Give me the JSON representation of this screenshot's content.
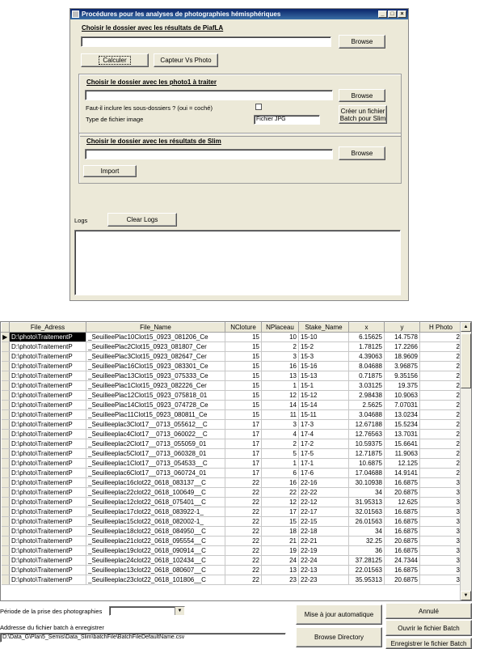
{
  "window": {
    "title": "Procédures pour les analyses de photographies hémisphériques",
    "minimize": "_",
    "maximize": "□",
    "close": "×"
  },
  "piafla": {
    "title": "Choisir le dossier avec les résultats de PiafLA",
    "path_value": "",
    "browse_label": "Browse",
    "calculer_label": "Calculer",
    "capteur_label": "Capteur Vs Photo"
  },
  "photo": {
    "title": "Choisir le dossier avec les photo1 à traiter",
    "path_value": "",
    "browse_label": "Browse",
    "subfolders_label": "Faut-il inclure les sous-dossiers ? (oui = coché)",
    "filetype_label": "Type de fichier image",
    "filetype_value": "Fichier JPG",
    "batch_label": "Créer un fichier Batch pour Slim"
  },
  "slim": {
    "title": "Choisir le dossier avec les résultats de Slim",
    "path_value": "",
    "browse_label": "Browse",
    "import_label": "Import"
  },
  "logs": {
    "label": "Logs",
    "clear_label": "Clear Logs",
    "text": ""
  },
  "table": {
    "columns": [
      "File_Adress",
      "File_Name",
      "NCloture",
      "NPlaceau",
      "Stake_Name",
      "x",
      "y",
      "H Photo"
    ],
    "rows": [
      [
        "D:\\photo\\TraitementP",
        "_SeuilleePlac10Clot15_0923_081206_Ce",
        "15",
        "10",
        "15-10",
        "6.15625",
        "14.7578",
        "2"
      ],
      [
        "D:\\photo\\TraitementP",
        "_SeuilleePlac2Clot15_0923_081807_Cer",
        "15",
        "2",
        "15-2",
        "1.78125",
        "17.2266",
        "2"
      ],
      [
        "D:\\photo\\TraitementP",
        "_SeuilleePlac3Clot15_0923_082647_Cer",
        "15",
        "3",
        "15-3",
        "4.39063",
        "18.9609",
        "2"
      ],
      [
        "D:\\photo\\TraitementP",
        "_SeuilleePlac16Clot15_0923_083301_Ce",
        "15",
        "16",
        "15-16",
        "8.04688",
        "3.96875",
        "2"
      ],
      [
        "D:\\photo\\TraitementP",
        "_SeuilleePlac13Clot15_0923_075333_Ce",
        "15",
        "13",
        "15-13",
        "0.71875",
        "9.35156",
        "2"
      ],
      [
        "D:\\photo\\TraitementP",
        "_SeuilleePlac1Clot15_0923_082226_Cer",
        "15",
        "1",
        "15-1",
        "3.03125",
        "19.375",
        "2"
      ],
      [
        "D:\\photo\\TraitementP",
        "_SeuilleePlac12Clot15_0923_075818_01",
        "15",
        "12",
        "15-12",
        "2.98438",
        "10.9063",
        "2"
      ],
      [
        "D:\\photo\\TraitementP",
        "_SeuilleePlac14Clot15_0923_074728_Ce",
        "15",
        "14",
        "15-14",
        "2.5625",
        "7.07031",
        "2"
      ],
      [
        "D:\\photo\\TraitementP",
        "_SeuilleePlac11Clot15_0923_080811_Ce",
        "15",
        "11",
        "15-11",
        "3.04688",
        "13.0234",
        "2"
      ],
      [
        "D:\\photo\\TraitementP",
        "_Seuilleeplac3Clot17__0713_055612__C",
        "17",
        "3",
        "17-3",
        "12.67188",
        "15.5234",
        "2"
      ],
      [
        "D:\\photo\\TraitementP",
        "_Seuilleeplac4Clot17__0713_060022__C",
        "17",
        "4",
        "17-4",
        "12.76563",
        "13.7031",
        "2"
      ],
      [
        "D:\\photo\\TraitementP",
        "_Seuilleeplac2Clot17__0713_055059_01",
        "17",
        "2",
        "17-2",
        "10.59375",
        "15.6641",
        "2"
      ],
      [
        "D:\\photo\\TraitementP",
        "_Seuilleeplac5Clot17__0713_060328_01",
        "17",
        "5",
        "17-5",
        "12.71875",
        "11.9063",
        "2"
      ],
      [
        "D:\\photo\\TraitementP",
        "_Seuilleeplac1Clot17__0713_054533__C",
        "17",
        "1",
        "17-1",
        "10.6875",
        "12.125",
        "2"
      ],
      [
        "D:\\photo\\TraitementP",
        "_Seuilleeplac6Clot17__0713_060724_01",
        "17",
        "6",
        "17-6",
        "17.04688",
        "14.9141",
        "2"
      ],
      [
        "D:\\photo\\TraitementP",
        "_Seuilleeplac16clot22_0618_083137__C",
        "22",
        "16",
        "22-16",
        "30.10938",
        "16.6875",
        "3"
      ],
      [
        "D:\\photo\\TraitementP",
        "_Seuilleeplac22clot22_0618_100649__C",
        "22",
        "22",
        "22-22",
        "34",
        "20.6875",
        "3"
      ],
      [
        "D:\\photo\\TraitementP",
        "_Seuilleeplac12clot22_0618_075401__C",
        "22",
        "12",
        "22-12",
        "31.95313",
        "12.625",
        "3"
      ],
      [
        "D:\\photo\\TraitementP",
        "_Seuilleeplac17clot22_0618_083922-1_",
        "22",
        "17",
        "22-17",
        "32.01563",
        "16.6875",
        "3"
      ],
      [
        "D:\\photo\\TraitementP",
        "_Seuilleeplac15clot22_0618_082002-1_",
        "22",
        "15",
        "22-15",
        "26.01563",
        "16.6875",
        "3"
      ],
      [
        "D:\\photo\\TraitementP",
        "_Seuilleeplac18clot22_0618_084950__C",
        "22",
        "18",
        "22-18",
        "34",
        "16.6875",
        "3"
      ],
      [
        "D:\\photo\\TraitementP",
        "_Seuilleeplac21clot22_0618_095554__C",
        "22",
        "21",
        "22-21",
        "32.25",
        "20.6875",
        "3"
      ],
      [
        "D:\\photo\\TraitementP",
        "_Seuilleeplac19clot22_0618_090914__C",
        "22",
        "19",
        "22-19",
        "36",
        "16.6875",
        "3"
      ],
      [
        "D:\\photo\\TraitementP",
        "_Seuilleeplac24clot22_0618_102434__C",
        "22",
        "24",
        "22-24",
        "37.28125",
        "24.7344",
        "3"
      ],
      [
        "D:\\photo\\TraitementP",
        "_Seuilleeplac13clot22_0618_080607__C",
        "22",
        "13",
        "22-13",
        "22.01563",
        "16.6875",
        "3"
      ],
      [
        "D:\\photo\\TraitementP",
        "_Seuilleeplac23clot22_0618_101806__C",
        "22",
        "23",
        "22-23",
        "35.95313",
        "20.6875",
        "3"
      ]
    ]
  },
  "bottom": {
    "periode_label": "Période de la prise des photographies",
    "periode_value": "",
    "batch_addr_label": "Addresse du fichier batch à enregistrer",
    "batch_addr_value": "D:\\Data_G\\Plan5_Semis\\Data_Slim\\batchFile\\BatchFileDefaultName.csv",
    "maj_label": "Mise à jour automatique",
    "annule_label": "Annulé",
    "ouvrir_label": "Ouvrir le fichier Batch",
    "browse_dir_label": "Browse Directory",
    "enregistrer_label": "Enregistrer le fichier Batch"
  }
}
